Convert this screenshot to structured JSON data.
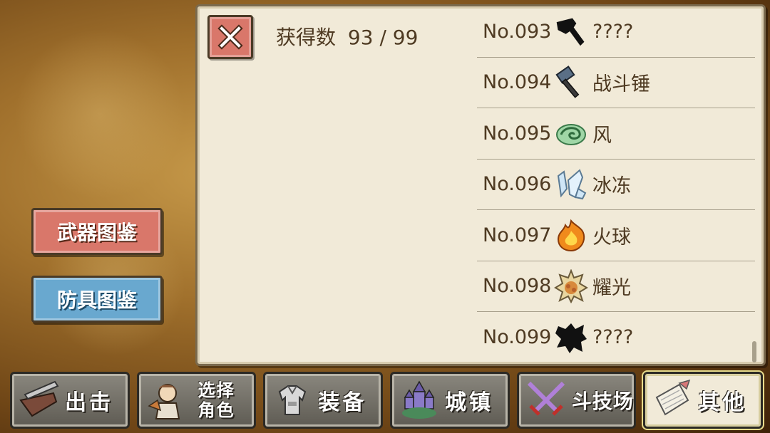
{
  "side_buttons": {
    "weapon_label": "武器图鉴",
    "armor_label": "防具图鉴"
  },
  "panel": {
    "obtained_label": "获得数",
    "obtained_value": "93 / 99",
    "items": [
      {
        "number": "No.093",
        "name": "????",
        "icon": "hammer-silhouette-icon"
      },
      {
        "number": "No.094",
        "name": "战斗锤",
        "icon": "war-hammer-icon"
      },
      {
        "number": "No.095",
        "name": "风",
        "icon": "wind-swirl-icon"
      },
      {
        "number": "No.096",
        "name": "冰冻",
        "icon": "ice-crystal-icon"
      },
      {
        "number": "No.097",
        "name": "火球",
        "icon": "fireball-icon"
      },
      {
        "number": "No.098",
        "name": "耀光",
        "icon": "radiant-light-icon"
      },
      {
        "number": "No.099",
        "name": "????",
        "icon": "unknown-silhouette-icon"
      }
    ]
  },
  "nav": {
    "sortie": "出击",
    "select_char_line1": "选择",
    "select_char_line2": "角色",
    "equip": "装备",
    "town": "城镇",
    "arena": "斗技场",
    "other": "其他"
  },
  "colors": {
    "weapon_button": "#d9776a",
    "armor_button": "#69a8cf",
    "panel_bg": "#f1ead8"
  }
}
